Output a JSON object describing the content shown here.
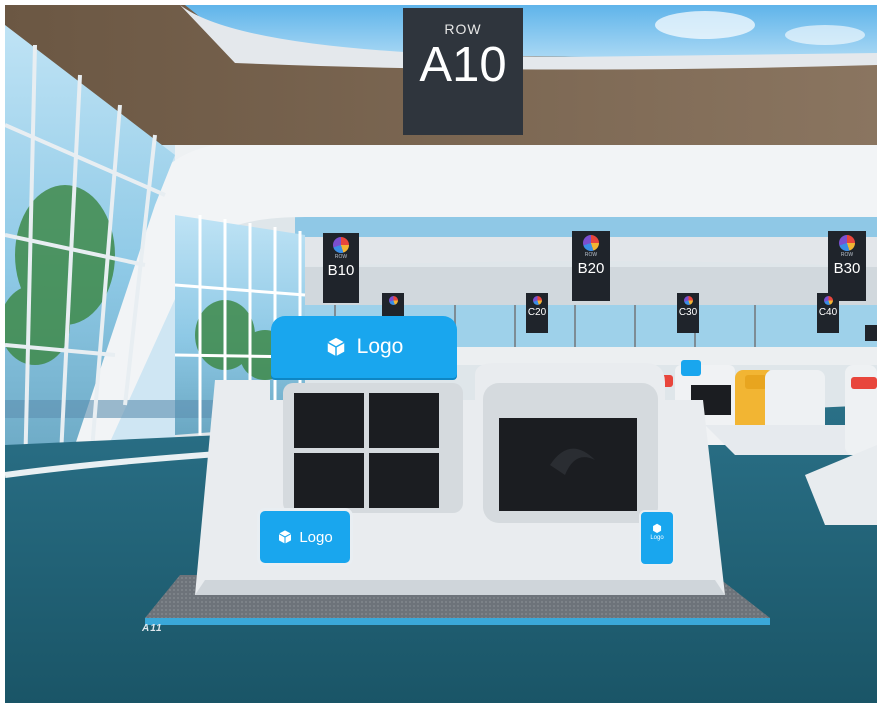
{
  "row_sign": {
    "label": "ROW",
    "number": "A10"
  },
  "hanging_banners": [
    {
      "code": "B10",
      "tiny": "ROW"
    },
    {
      "code": "B20",
      "tiny": "ROW"
    },
    {
      "code": "B30",
      "tiny": "ROW"
    },
    {
      "code": "C20",
      "tiny": "ROW"
    },
    {
      "code": "C30",
      "tiny": "ROW"
    },
    {
      "code": "C40",
      "tiny": "ROW"
    }
  ],
  "booth": {
    "top_logo_text": "Logo",
    "front_logo_text": "Logo",
    "floor_label": "A11",
    "small_sign_text": "Logo"
  },
  "colors": {
    "booth_accent": "#19a6ee",
    "carpet": "#1f5f73",
    "sign_bg": "#2f353d",
    "booth_white": "#e9ecef",
    "screen": "#1b1d21",
    "accent_red": "#e8463c",
    "accent_yellow": "#f2b533"
  },
  "icons": [
    "cube-logo-icon",
    "emblem-icon"
  ]
}
